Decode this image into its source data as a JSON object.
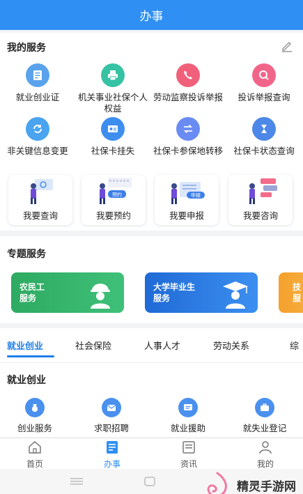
{
  "header": {
    "title": "办事"
  },
  "my_services": {
    "title": "我的服务",
    "items": [
      {
        "label": "就业创业证",
        "icon": "id-card-icon"
      },
      {
        "label": "机关事业社保个人权益",
        "icon": "printer-icon"
      },
      {
        "label": "劳动监察投诉举报",
        "icon": "phone-icon"
      },
      {
        "label": "投诉举报查询",
        "icon": "magnifier-icon"
      },
      {
        "label": "非关键信息变更",
        "icon": "refresh-icon"
      },
      {
        "label": "社保卡挂失",
        "icon": "card-icon"
      },
      {
        "label": "社保卡参保地转移",
        "icon": "transfer-icon"
      },
      {
        "label": "社保卡状态查询",
        "icon": "hourglass-icon"
      }
    ],
    "quick": [
      {
        "label": "我要查询"
      },
      {
        "label": "我要预约",
        "tag": "预约"
      },
      {
        "label": "我要申报",
        "tag": "申报"
      },
      {
        "label": "我要咨询"
      }
    ]
  },
  "special_services": {
    "title": "专题服务",
    "banners": [
      {
        "line1": "农民工",
        "line2": "服务",
        "color": "#2fb56b"
      },
      {
        "line1": "大学毕业生",
        "line2": "服务",
        "color": "#1e6fd9"
      },
      {
        "line1": "技",
        "line2": "服",
        "color": "#f59a23"
      }
    ]
  },
  "tabs": [
    "就业创业",
    "社会保险",
    "人事人才",
    "劳动关系",
    "综"
  ],
  "employment": {
    "title": "就业创业",
    "items": [
      {
        "label": "创业服务",
        "icon": "bag-icon"
      },
      {
        "label": "求职招聘",
        "icon": "envelope-icon"
      },
      {
        "label": "就业援助",
        "icon": "message-icon"
      },
      {
        "label": "就失业登记",
        "icon": "briefcase-icon"
      }
    ]
  },
  "bottom_nav": [
    {
      "label": "首页",
      "icon": "home-icon"
    },
    {
      "label": "办事",
      "icon": "document-icon"
    },
    {
      "label": "资讯",
      "icon": "news-icon"
    },
    {
      "label": "我的",
      "icon": "user-icon"
    }
  ],
  "watermark": {
    "text": "精灵手游网"
  },
  "colors": {
    "primary": "#2f8ff2",
    "accent": "#1f7fe8"
  }
}
